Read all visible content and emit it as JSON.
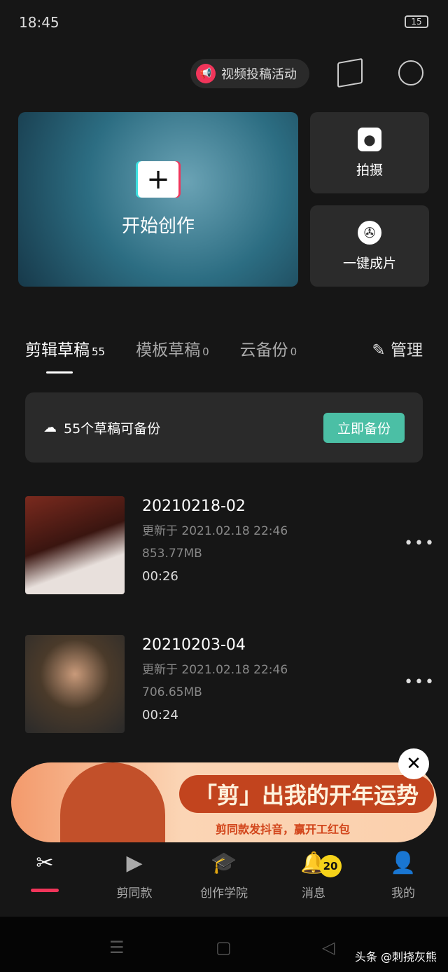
{
  "status": {
    "time": "18:45",
    "battery": "15"
  },
  "header": {
    "promo_label": "视频投稿活动"
  },
  "hero": {
    "label": "开始创作"
  },
  "side": [
    {
      "label": "拍摄"
    },
    {
      "label": "一键成片"
    }
  ],
  "tabs": [
    {
      "label": "剪辑草稿",
      "count": "55"
    },
    {
      "label": "模板草稿",
      "count": "0"
    },
    {
      "label": "云备份",
      "count": "0"
    }
  ],
  "manage_label": "管理",
  "backup": {
    "text": "55个草稿可备份",
    "button": "立即备份"
  },
  "drafts": [
    {
      "title": "20210218-02",
      "updated": "更新于 2021.02.18 22:46",
      "size": "853.77MB",
      "duration": "00:26"
    },
    {
      "title": "20210203-04",
      "updated": "更新于 2021.02.18 22:46",
      "size": "706.65MB",
      "duration": "00:24"
    }
  ],
  "banner": {
    "title": "「剪」出我的开年运势",
    "subtitle": "剪同款发抖音，赢开工红包"
  },
  "nav": [
    {
      "label": ""
    },
    {
      "label": "剪同款"
    },
    {
      "label": "创作学院"
    },
    {
      "label": "消息",
      "badge": "20"
    },
    {
      "label": "我的"
    }
  ],
  "watermark": "头条 @刺挠灰熊",
  "colors": {
    "accent": "#f0355a",
    "backup_button": "#4bbfa5",
    "badge": "#f6d31a"
  }
}
